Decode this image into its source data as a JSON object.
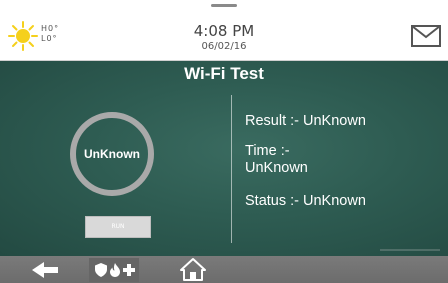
{
  "header": {
    "weather": {
      "high": "H0°",
      "low": "L0°",
      "icon": "sun-icon"
    },
    "time": "4:08 PM",
    "date": "06/02/16",
    "mail_icon": "envelope-icon"
  },
  "main": {
    "title": "Wi-Fi Test",
    "ring_label": "UnKnown",
    "run_label": "RUN",
    "result_text": "Result :- UnKnown",
    "time_label": "Time :-",
    "time_value": "UnKnown",
    "status_text": "Status :- UnKnown"
  },
  "bottom_bar": {
    "back_icon": "arrow-left-icon",
    "emergency_icons": [
      "shield-icon",
      "flame-icon",
      "plus-icon"
    ],
    "home_icon": "house-icon"
  },
  "colors": {
    "panel": "#2e5c52",
    "ring": "#a9a9a9",
    "sun": "#f5d01c",
    "bottom_bar": "#6e6e6e"
  }
}
